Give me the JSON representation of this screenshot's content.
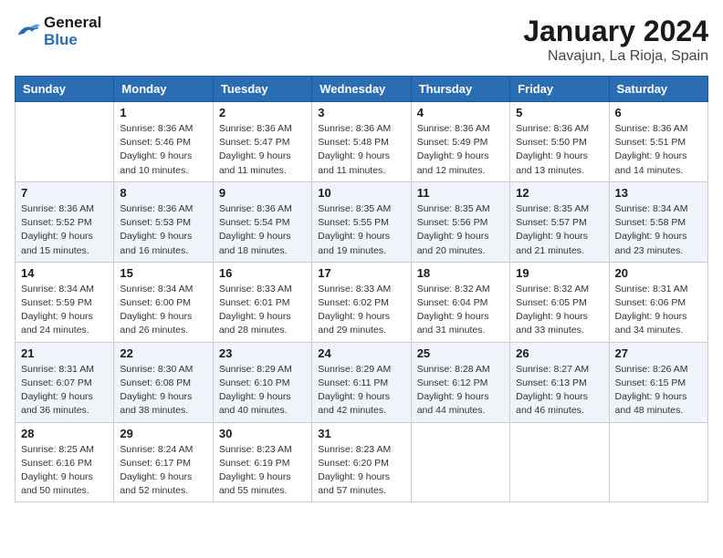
{
  "header": {
    "logo_general": "General",
    "logo_blue": "Blue",
    "month": "January 2024",
    "location": "Navajun, La Rioja, Spain"
  },
  "weekdays": [
    "Sunday",
    "Monday",
    "Tuesday",
    "Wednesday",
    "Thursday",
    "Friday",
    "Saturday"
  ],
  "weeks": [
    [
      {
        "day": "",
        "sunrise": "",
        "sunset": "",
        "daylight": ""
      },
      {
        "day": "1",
        "sunrise": "Sunrise: 8:36 AM",
        "sunset": "Sunset: 5:46 PM",
        "daylight": "Daylight: 9 hours and 10 minutes."
      },
      {
        "day": "2",
        "sunrise": "Sunrise: 8:36 AM",
        "sunset": "Sunset: 5:47 PM",
        "daylight": "Daylight: 9 hours and 11 minutes."
      },
      {
        "day": "3",
        "sunrise": "Sunrise: 8:36 AM",
        "sunset": "Sunset: 5:48 PM",
        "daylight": "Daylight: 9 hours and 11 minutes."
      },
      {
        "day": "4",
        "sunrise": "Sunrise: 8:36 AM",
        "sunset": "Sunset: 5:49 PM",
        "daylight": "Daylight: 9 hours and 12 minutes."
      },
      {
        "day": "5",
        "sunrise": "Sunrise: 8:36 AM",
        "sunset": "Sunset: 5:50 PM",
        "daylight": "Daylight: 9 hours and 13 minutes."
      },
      {
        "day": "6",
        "sunrise": "Sunrise: 8:36 AM",
        "sunset": "Sunset: 5:51 PM",
        "daylight": "Daylight: 9 hours and 14 minutes."
      }
    ],
    [
      {
        "day": "7",
        "sunrise": "Sunrise: 8:36 AM",
        "sunset": "Sunset: 5:52 PM",
        "daylight": "Daylight: 9 hours and 15 minutes."
      },
      {
        "day": "8",
        "sunrise": "Sunrise: 8:36 AM",
        "sunset": "Sunset: 5:53 PM",
        "daylight": "Daylight: 9 hours and 16 minutes."
      },
      {
        "day": "9",
        "sunrise": "Sunrise: 8:36 AM",
        "sunset": "Sunset: 5:54 PM",
        "daylight": "Daylight: 9 hours and 18 minutes."
      },
      {
        "day": "10",
        "sunrise": "Sunrise: 8:35 AM",
        "sunset": "Sunset: 5:55 PM",
        "daylight": "Daylight: 9 hours and 19 minutes."
      },
      {
        "day": "11",
        "sunrise": "Sunrise: 8:35 AM",
        "sunset": "Sunset: 5:56 PM",
        "daylight": "Daylight: 9 hours and 20 minutes."
      },
      {
        "day": "12",
        "sunrise": "Sunrise: 8:35 AM",
        "sunset": "Sunset: 5:57 PM",
        "daylight": "Daylight: 9 hours and 21 minutes."
      },
      {
        "day": "13",
        "sunrise": "Sunrise: 8:34 AM",
        "sunset": "Sunset: 5:58 PM",
        "daylight": "Daylight: 9 hours and 23 minutes."
      }
    ],
    [
      {
        "day": "14",
        "sunrise": "Sunrise: 8:34 AM",
        "sunset": "Sunset: 5:59 PM",
        "daylight": "Daylight: 9 hours and 24 minutes."
      },
      {
        "day": "15",
        "sunrise": "Sunrise: 8:34 AM",
        "sunset": "Sunset: 6:00 PM",
        "daylight": "Daylight: 9 hours and 26 minutes."
      },
      {
        "day": "16",
        "sunrise": "Sunrise: 8:33 AM",
        "sunset": "Sunset: 6:01 PM",
        "daylight": "Daylight: 9 hours and 28 minutes."
      },
      {
        "day": "17",
        "sunrise": "Sunrise: 8:33 AM",
        "sunset": "Sunset: 6:02 PM",
        "daylight": "Daylight: 9 hours and 29 minutes."
      },
      {
        "day": "18",
        "sunrise": "Sunrise: 8:32 AM",
        "sunset": "Sunset: 6:04 PM",
        "daylight": "Daylight: 9 hours and 31 minutes."
      },
      {
        "day": "19",
        "sunrise": "Sunrise: 8:32 AM",
        "sunset": "Sunset: 6:05 PM",
        "daylight": "Daylight: 9 hours and 33 minutes."
      },
      {
        "day": "20",
        "sunrise": "Sunrise: 8:31 AM",
        "sunset": "Sunset: 6:06 PM",
        "daylight": "Daylight: 9 hours and 34 minutes."
      }
    ],
    [
      {
        "day": "21",
        "sunrise": "Sunrise: 8:31 AM",
        "sunset": "Sunset: 6:07 PM",
        "daylight": "Daylight: 9 hours and 36 minutes."
      },
      {
        "day": "22",
        "sunrise": "Sunrise: 8:30 AM",
        "sunset": "Sunset: 6:08 PM",
        "daylight": "Daylight: 9 hours and 38 minutes."
      },
      {
        "day": "23",
        "sunrise": "Sunrise: 8:29 AM",
        "sunset": "Sunset: 6:10 PM",
        "daylight": "Daylight: 9 hours and 40 minutes."
      },
      {
        "day": "24",
        "sunrise": "Sunrise: 8:29 AM",
        "sunset": "Sunset: 6:11 PM",
        "daylight": "Daylight: 9 hours and 42 minutes."
      },
      {
        "day": "25",
        "sunrise": "Sunrise: 8:28 AM",
        "sunset": "Sunset: 6:12 PM",
        "daylight": "Daylight: 9 hours and 44 minutes."
      },
      {
        "day": "26",
        "sunrise": "Sunrise: 8:27 AM",
        "sunset": "Sunset: 6:13 PM",
        "daylight": "Daylight: 9 hours and 46 minutes."
      },
      {
        "day": "27",
        "sunrise": "Sunrise: 8:26 AM",
        "sunset": "Sunset: 6:15 PM",
        "daylight": "Daylight: 9 hours and 48 minutes."
      }
    ],
    [
      {
        "day": "28",
        "sunrise": "Sunrise: 8:25 AM",
        "sunset": "Sunset: 6:16 PM",
        "daylight": "Daylight: 9 hours and 50 minutes."
      },
      {
        "day": "29",
        "sunrise": "Sunrise: 8:24 AM",
        "sunset": "Sunset: 6:17 PM",
        "daylight": "Daylight: 9 hours and 52 minutes."
      },
      {
        "day": "30",
        "sunrise": "Sunrise: 8:23 AM",
        "sunset": "Sunset: 6:19 PM",
        "daylight": "Daylight: 9 hours and 55 minutes."
      },
      {
        "day": "31",
        "sunrise": "Sunrise: 8:23 AM",
        "sunset": "Sunset: 6:20 PM",
        "daylight": "Daylight: 9 hours and 57 minutes."
      },
      {
        "day": "",
        "sunrise": "",
        "sunset": "",
        "daylight": ""
      },
      {
        "day": "",
        "sunrise": "",
        "sunset": "",
        "daylight": ""
      },
      {
        "day": "",
        "sunrise": "",
        "sunset": "",
        "daylight": ""
      }
    ]
  ]
}
